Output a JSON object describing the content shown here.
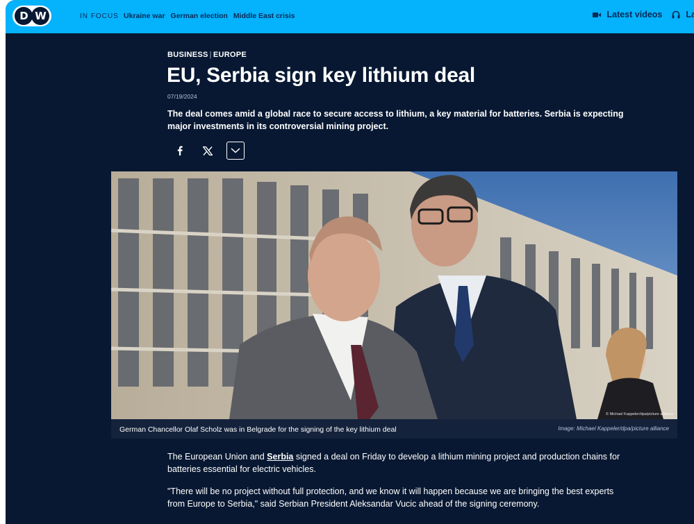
{
  "header": {
    "logo_text": "DW",
    "in_focus_label": "IN FOCUS",
    "focus_links": [
      "Ukraine war",
      "German election",
      "Middle East crisis"
    ],
    "latest_videos_label": "Latest videos",
    "latest_audio_label": "Latest audio"
  },
  "article": {
    "kicker_category": "BUSINESS",
    "kicker_region": "EUROPE",
    "headline": "EU, Serbia sign key lithium deal",
    "date": "07/19/2024",
    "lede": "The deal comes amid a global race to secure access to lithium, a key material for batteries. Serbia is expecting major investments in its controversial mining project.",
    "share": {
      "facebook_icon": "facebook-icon",
      "x_icon": "x-icon",
      "more_icon": "chevron-down-icon"
    },
    "image": {
      "overlay_credit": "© Michael Kappeler/dpa/picture alliance",
      "caption": "German Chancellor Olaf Scholz was in Belgrade for the signing of the key lithium deal",
      "credit": "Image: Michael Kappeler/dpa/picture alliance"
    },
    "paragraph1_before": "The European Union and ",
    "paragraph1_link": "Serbia",
    "paragraph1_after": " signed a deal on Friday to develop a lithium mining project and production chains for batteries essential for electric vehicles.",
    "paragraph2": "\"There will be no project without full protection, and we know it will happen because we are bringing the best experts from Europe to Serbia,\" said Serbian President Aleksandar Vucic ahead of the signing ceremony."
  },
  "colors": {
    "header_bg": "#05b2fc",
    "page_bg": "#081832",
    "caption_bg": "#14223c"
  }
}
